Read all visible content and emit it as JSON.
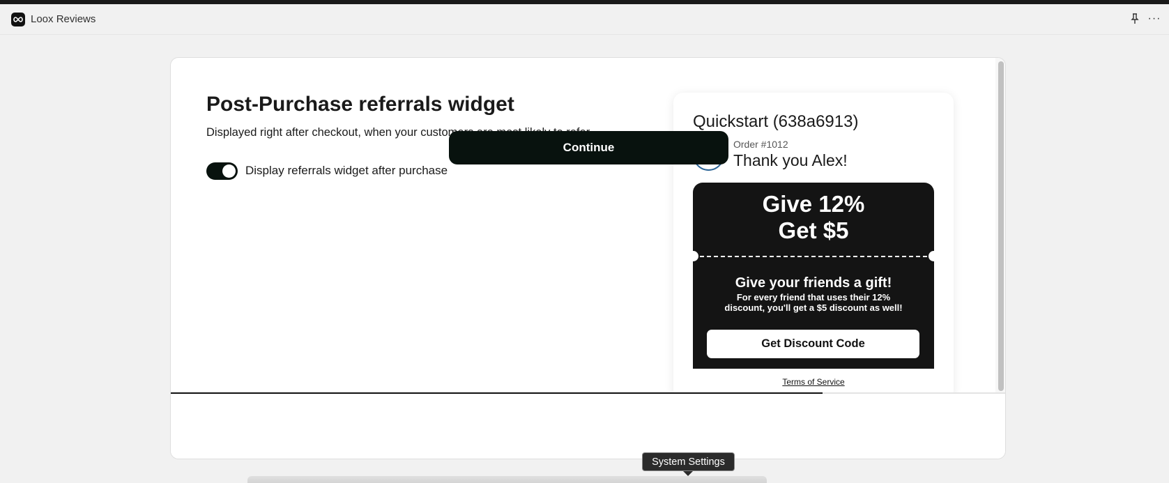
{
  "app": {
    "title": "Loox Reviews",
    "logo_icon": "infinity-icon",
    "pin_icon": "pin-icon",
    "more_label": "···"
  },
  "widget": {
    "title": "Post-Purchase referrals widget",
    "subtitle": "Displayed right after checkout, when your customers are most likely to refer",
    "toggle_label": "Display referrals widget after purchase",
    "toggle_on": true
  },
  "preview": {
    "store_name": "Quickstart (638a6913)",
    "order_number": "Order #1012",
    "thank_you": "Thank you Alex!",
    "give_line": "Give 12%",
    "get_line": "Get $5",
    "gift_heading": "Give your friends a gift!",
    "gift_body": "For every friend that uses their 12% discount, you'll get a $5 discount as well!",
    "code_button": "Get Discount Code",
    "terms": "Terms of Service"
  },
  "footer": {
    "continue_label": "Continue",
    "progress_fraction": 0.78
  },
  "tooltip": {
    "label": "System Settings"
  },
  "colors": {
    "accent_dark": "#08120e",
    "ticket_bg": "#141414",
    "check_blue": "#2a6496"
  }
}
